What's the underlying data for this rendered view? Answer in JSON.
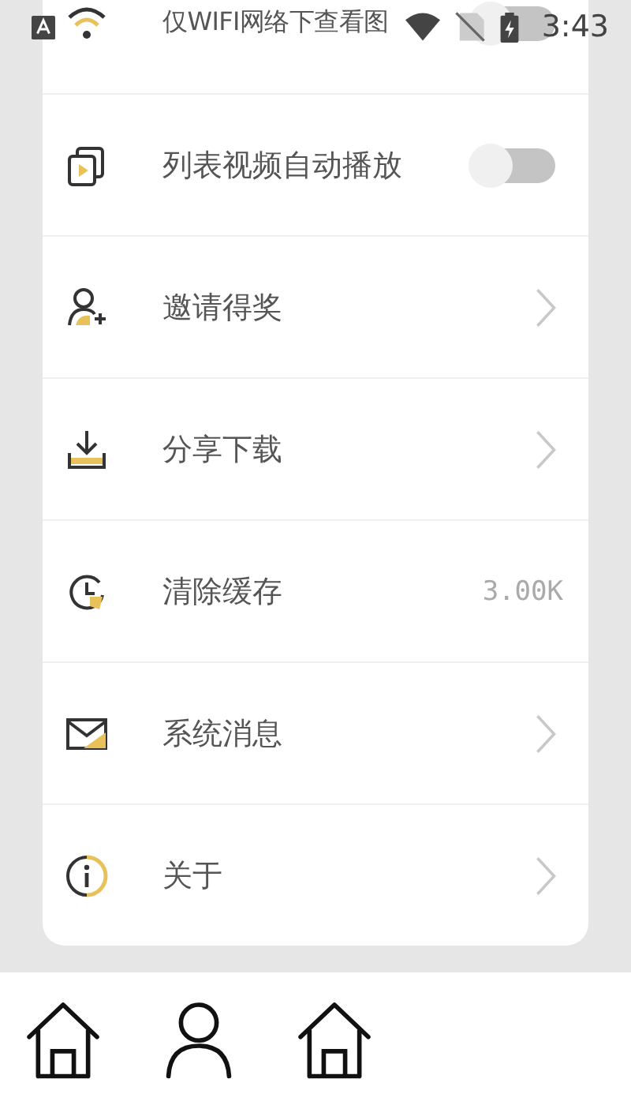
{
  "status_bar": {
    "time": "3:43"
  },
  "settings": [
    {
      "kind": "toggle",
      "label": "仅WIFI网络下查看图",
      "on": false
    },
    {
      "kind": "toggle",
      "label": "列表视频自动播放",
      "on": false
    },
    {
      "kind": "link",
      "label": "邀请得奖"
    },
    {
      "kind": "link",
      "label": "分享下载"
    },
    {
      "kind": "value",
      "label": "清除缓存",
      "value": "3.00K"
    },
    {
      "kind": "link",
      "label": "系统消息"
    },
    {
      "kind": "link",
      "label": "关于"
    }
  ]
}
